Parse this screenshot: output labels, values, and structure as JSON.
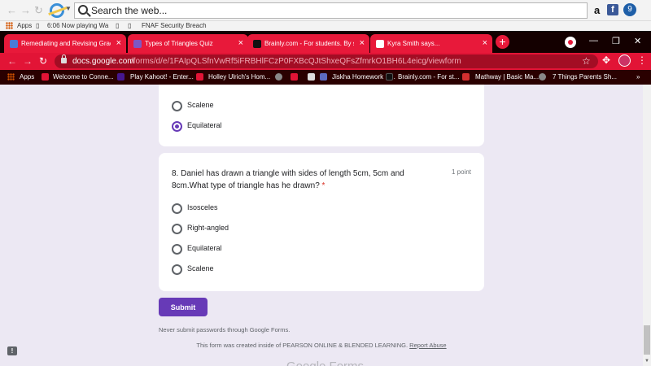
{
  "outer_toolbar": {
    "back": "←",
    "forward": "→",
    "refresh": "↻",
    "search_placeholder": "Search the web...",
    "amazon": "a",
    "facebook": "f",
    "extension": "9"
  },
  "favorites_bar": {
    "items": [
      "Apps",
      "6:06 Now playing Wa",
      "FNAF Security Breach"
    ]
  },
  "tabs": [
    {
      "label": "Remediating and Revising Grades",
      "close": "×",
      "color": "#4a7bd6"
    },
    {
      "label": "Types of Triangles Quiz",
      "close": "×",
      "color": "#7e57c2"
    },
    {
      "label": "Brainly.com - For students. By stu",
      "close": "×",
      "color": "#111111"
    },
    {
      "label": "Kyra Smith says...",
      "close": "×",
      "color": "#e8193a"
    }
  ],
  "new_tab": "+",
  "window_controls": {
    "minimize": "—",
    "restore": "❐",
    "close": "✕"
  },
  "address_bar": {
    "back": "←",
    "forward": "→",
    "refresh": "↻",
    "domain": "docs.google.com",
    "path": "/forms/d/e/1FAIpQLSfnVwRf5iFRBHlFCzP0FXBcQJtShxeQFsZfmrkO1BH6L4eicg/viewform",
    "star": "☆",
    "puzzle": "✥",
    "menu": "⋮"
  },
  "bookmarks": [
    {
      "label": "Apps",
      "icon_color": "#d35400"
    },
    {
      "label": "Welcome to Conne...",
      "icon_color": "#e21436"
    },
    {
      "label": "Play Kahoot! - Enter...",
      "icon_color": "#46178f"
    },
    {
      "label": "Holley Ulrich's Hom...",
      "icon_color": "#e21436"
    },
    {
      "label": "",
      "icon_color": "#888888"
    },
    {
      "label": "",
      "icon_color": "#e21436"
    },
    {
      "label": "",
      "icon_color": "#dddddd"
    },
    {
      "label": "Jiskha Homework H...",
      "icon_color": "#5c6bc0"
    },
    {
      "label": "Brainly.com - For st...",
      "icon_color": "#111111"
    },
    {
      "label": "Mathway | Basic Ma...",
      "icon_color": "#d32f2f"
    },
    {
      "label": "7 Things Parents Sh...",
      "icon_color": "#888888"
    }
  ],
  "bookmarks_more": "»",
  "prev_question": {
    "options": [
      {
        "label": "Scalene",
        "selected": false
      },
      {
        "label": "Equilateral",
        "selected": true
      }
    ]
  },
  "question8": {
    "title": "8. Daniel has drawn a triangle with sides of length 5cm, 5cm and 8cm.What type of triangle has he drawn?",
    "required_mark": "*",
    "points": "1 point",
    "options": [
      {
        "label": "Isosceles",
        "selected": false
      },
      {
        "label": "Right-angled",
        "selected": false
      },
      {
        "label": "Equilateral",
        "selected": false
      },
      {
        "label": "Scalene",
        "selected": false
      }
    ]
  },
  "submit_label": "Submit",
  "never_note": "Never submit passwords through Google Forms.",
  "footer": {
    "created_text": "This form was created inside of PEARSON ONLINE & BLENDED LEARNING.",
    "report_abuse": "Report Abuse"
  },
  "logo_text": "Google Forms",
  "feedback": "!"
}
